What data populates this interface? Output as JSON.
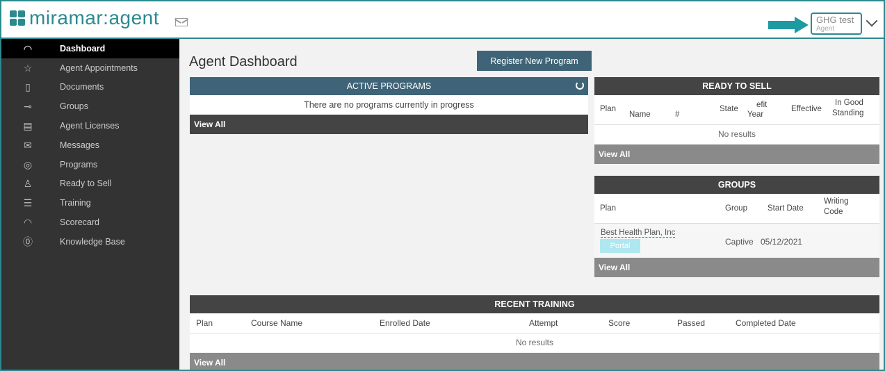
{
  "header": {
    "brand_prefix": "miramar",
    "brand_suffix": ":agent",
    "user_name": "GHG test",
    "user_role": "Agent"
  },
  "sidebar": {
    "items": [
      {
        "label": "Dashboard",
        "icon": "gauge-icon",
        "active": true
      },
      {
        "label": "Agent Appointments",
        "icon": "star-icon"
      },
      {
        "label": "Documents",
        "icon": "document-icon"
      },
      {
        "label": "Groups",
        "icon": "key-icon"
      },
      {
        "label": "Agent Licenses",
        "icon": "license-icon"
      },
      {
        "label": "Messages",
        "icon": "envelope-icon"
      },
      {
        "label": "Programs",
        "icon": "eye-icon"
      },
      {
        "label": "Ready to Sell",
        "icon": "thumbs-up-icon"
      },
      {
        "label": "Training",
        "icon": "list-icon"
      },
      {
        "label": "Scorecard",
        "icon": "gauge-icon"
      },
      {
        "label": "Knowledge Base",
        "icon": "question-icon"
      }
    ]
  },
  "main": {
    "title": "Agent Dashboard",
    "register_label": "Register New Program",
    "active_programs": {
      "title": "ACTIVE PROGRAMS",
      "empty": "There are no programs currently in progress",
      "view_all": "View All"
    },
    "ready_to_sell": {
      "title": "READY TO SELL",
      "columns": [
        "Plan",
        "Name",
        "#",
        "State",
        "efit",
        "Year",
        "Effective",
        "In Good",
        "Standing"
      ],
      "empty": "No results",
      "view_all": "View All"
    },
    "groups": {
      "title": "GROUPS",
      "columns": [
        "Plan",
        "Group",
        "Start Date",
        "Writing",
        "Code"
      ],
      "rows": [
        {
          "plan": "Best Health Plan, Inc",
          "button": "Portal",
          "group": "Captive",
          "start_date": "05/12/2021"
        }
      ],
      "view_all": "View All"
    },
    "recent_training": {
      "title": "RECENT TRAINING",
      "columns": [
        "Plan",
        "Course Name",
        "Enrolled Date",
        "Attempt",
        "Score",
        "Passed",
        "Completed Date"
      ],
      "empty": "No results",
      "view_all": "View All"
    }
  },
  "colors": {
    "accent": "#2a8a8f",
    "panel_blue": "#3f6478",
    "sidebar_bg": "#333333",
    "panel_dark": "#444444",
    "view_all_gray": "#8a8a8a",
    "portal_button": "#aee7f0"
  }
}
